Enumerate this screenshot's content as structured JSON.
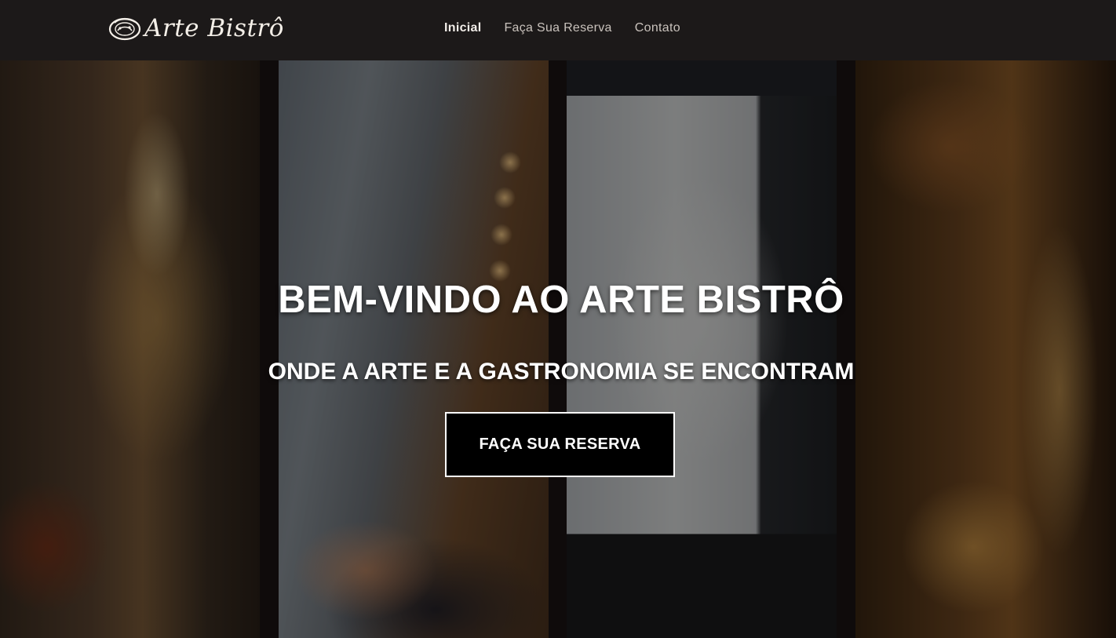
{
  "navbar": {
    "logo_text": "Arte Bistrô",
    "logo_icon": "palette-plate-icon",
    "links": [
      {
        "label": "Inicial",
        "active": true
      },
      {
        "label": "Faça Sua Reserva",
        "active": false
      },
      {
        "label": "Contato",
        "active": false
      }
    ]
  },
  "hero": {
    "title": "BEM-VINDO AO ARTE BISTRÔ",
    "subtitle": "ONDE A ARTE E A GASTRONOMIA SE ENCONTRAM",
    "cta_label": "FAÇA SUA RESERVA",
    "panels": [
      "restaurant-interior-photo",
      "shrimp-risotto-photo",
      "kitchen-photo",
      "dining-hall-photo"
    ]
  },
  "colors": {
    "navbar_bg": "#1c1919",
    "nav_link": "#c9c2bc",
    "cta_bg": "#000000",
    "cta_border": "#ffffff",
    "text": "#ffffff"
  }
}
